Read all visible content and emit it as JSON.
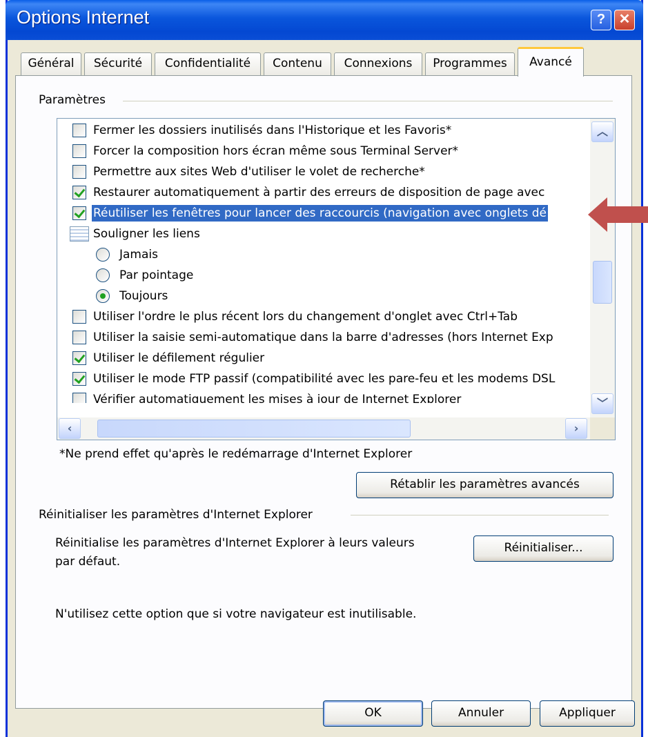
{
  "window": {
    "title": "Options Internet",
    "help_symbol": "?",
    "close_symbol": "✕"
  },
  "tabs": [
    {
      "label": "Général"
    },
    {
      "label": "Sécurité"
    },
    {
      "label": "Confidentialité"
    },
    {
      "label": "Contenu"
    },
    {
      "label": "Connexions"
    },
    {
      "label": "Programmes"
    },
    {
      "label": "Avancé",
      "active": true
    }
  ],
  "settings": {
    "group_title": "Paramètres",
    "items": [
      {
        "type": "checkbox",
        "checked": false,
        "label": "Fermer les dossiers inutilisés dans l'Historique et les Favoris*"
      },
      {
        "type": "checkbox",
        "checked": false,
        "label": "Forcer la composition hors écran même sous Terminal Server*"
      },
      {
        "type": "checkbox",
        "checked": false,
        "label": "Permettre aux sites Web d'utiliser le volet de recherche*"
      },
      {
        "type": "checkbox",
        "checked": true,
        "label": "Restaurer automatiquement à partir des erreurs de disposition de page avec"
      },
      {
        "type": "checkbox",
        "checked": true,
        "selected": true,
        "label": "Réutiliser les fenêtres pour lancer des raccourcis (navigation avec onglets dé"
      },
      {
        "type": "group",
        "label": "Souligner les liens"
      },
      {
        "type": "radio",
        "checked": false,
        "label": "Jamais"
      },
      {
        "type": "radio",
        "checked": false,
        "label": "Par pointage"
      },
      {
        "type": "radio",
        "checked": true,
        "label": "Toujours"
      },
      {
        "type": "checkbox",
        "checked": false,
        "label": "Utiliser l'ordre le plus récent lors du changement d'onglet avec Ctrl+Tab"
      },
      {
        "type": "checkbox",
        "checked": false,
        "label": "Utiliser la saisie semi-automatique dans la barre d'adresses (hors Internet Exp"
      },
      {
        "type": "checkbox",
        "checked": true,
        "label": "Utiliser le défilement régulier"
      },
      {
        "type": "checkbox",
        "checked": true,
        "label": "Utiliser le mode FTP passif (compatibilité avec les pare-feu et les modems DSL"
      },
      {
        "type": "checkbox",
        "checked": false,
        "label": "Vérifier automatiquement les mises à jour de Internet Explorer"
      }
    ],
    "restart_note": "*Ne prend effet qu'après le redémarrage d'Internet Explorer",
    "restore_button": "Rétablir les paramètres avancés"
  },
  "reset": {
    "group_title": "Réinitialiser les paramètres d'Internet Explorer",
    "description_line1": "Réinitialise les paramètres d'Internet Explorer à leurs valeurs",
    "description_line2": "par défaut.",
    "reset_button": "Réinitialiser...",
    "warning": "N'utilisez cette option que si votre navigateur est inutilisable."
  },
  "footer": {
    "ok": "OK",
    "cancel": "Annuler",
    "apply": "Appliquer"
  },
  "colors": {
    "title_bar": "#0a56dc",
    "selection": "#316ac5",
    "arrow": "#c0504d",
    "active_tab": "#ffc83c"
  }
}
